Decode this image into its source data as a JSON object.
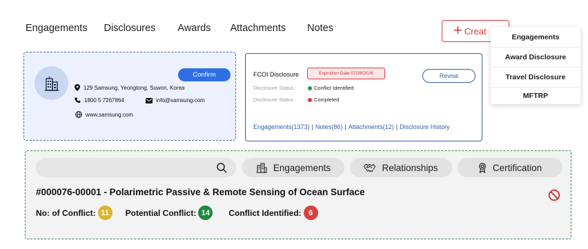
{
  "nav": {
    "items": [
      "Engagements",
      "Disclosures",
      "Awards",
      "Attachments",
      "Notes"
    ]
  },
  "create": {
    "icon": "plus-icon",
    "label": "Creat"
  },
  "dropdown": {
    "items": [
      "Engagements",
      "Award Disclosure",
      "Travel Disclosure",
      "MFTRP"
    ]
  },
  "company": {
    "icon": "building-icon",
    "address": "129 Samsung, Yeongtong, Suwon, Korea",
    "phone": "1800 5 7267864",
    "email": "info@samsung.com",
    "website": "www.samsung.com",
    "confirm_label": "Confirm"
  },
  "fcoi": {
    "title": "FCOI Disclosure",
    "expiration": "Expiration Date:07/28/2026",
    "revise_label": "Revise",
    "statuses": [
      {
        "label": "Disclosure Status :",
        "value": "Conflict Identified",
        "color": "#1e9e3a"
      },
      {
        "label": "Disclosure Status :",
        "value": "Completed",
        "color": "#e0383a"
      }
    ],
    "links": [
      "Engagements(1373)",
      "Notes(86)",
      "Attachments(12)",
      "Disclosure History"
    ]
  },
  "panel": {
    "search_placeholder": "",
    "tabs": [
      {
        "label": "Engagements",
        "icon": "city-icon"
      },
      {
        "label": "Relationships",
        "icon": "handshake-icon"
      },
      {
        "label": "Certification",
        "icon": "award-icon"
      }
    ],
    "project_title": "#000076-00001 - Polarimetric Passive & Remote Sensing of Ocean Surface",
    "counts": [
      {
        "label": "No: of Conflict:",
        "value": "11",
        "color": "#d9b62a"
      },
      {
        "label": "Potential Conflict:",
        "value": "14",
        "color": "#1f8a3e"
      },
      {
        "label": "Conflict Identified:",
        "value": "6",
        "color": "#d94040"
      }
    ]
  },
  "colors": {
    "accent_blue": "#2f6fe2",
    "danger_red": "#e0383a",
    "card_bg": "#edf1fd"
  }
}
